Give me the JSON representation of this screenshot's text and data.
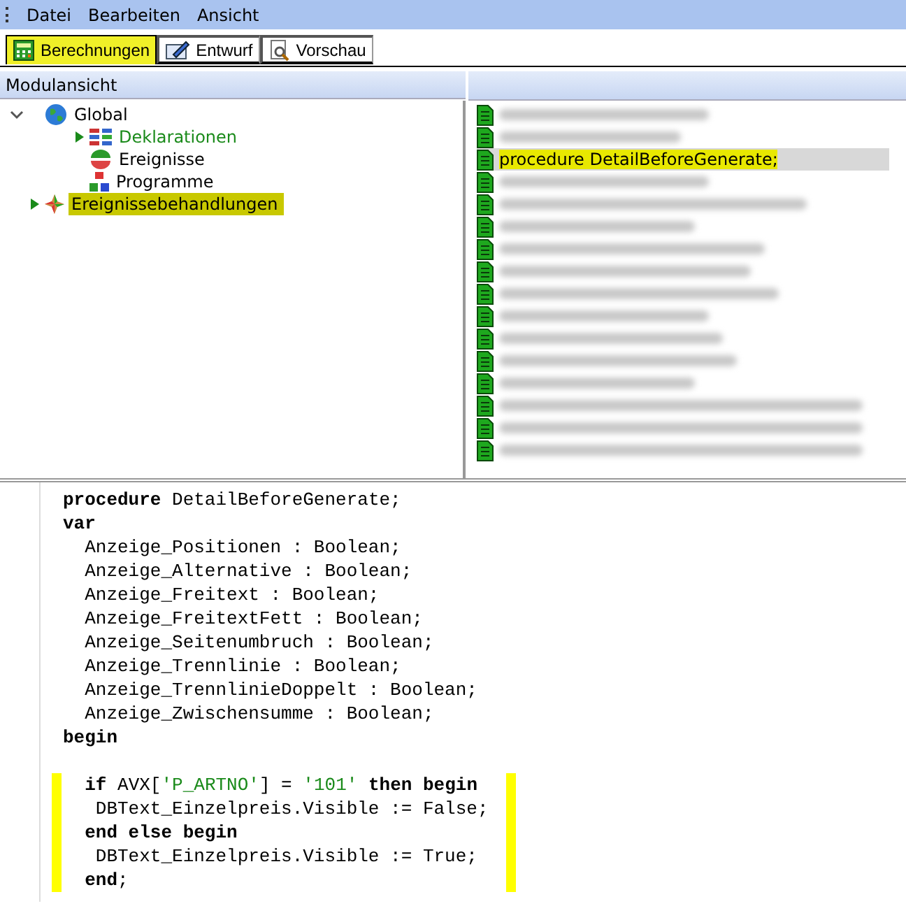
{
  "menu": [
    "Datei",
    "Bearbeiten",
    "Ansicht"
  ],
  "tabs": [
    {
      "label": "Berechnungen",
      "selected": true
    },
    {
      "label": "Entwurf",
      "selected": false
    },
    {
      "label": "Vorschau",
      "selected": false
    }
  ],
  "module_view": {
    "title": "Modulansicht",
    "tree": [
      {
        "label": "Global",
        "expanded": true,
        "selected": false,
        "active": false,
        "children": [
          {
            "label": "Deklarationen",
            "selected": false,
            "active": true
          },
          {
            "label": "Ereignisse",
            "selected": false,
            "active": false
          },
          {
            "label": "Programme",
            "selected": false,
            "active": false
          }
        ]
      },
      {
        "label": "Ereignissebehandlungen",
        "selected": true,
        "active": false
      }
    ]
  },
  "procedures": [
    {
      "kind": "blurred"
    },
    {
      "kind": "blurred"
    },
    {
      "kind": "text",
      "text": "procedure DetailBeforeGenerate;",
      "selected": true
    },
    {
      "kind": "blurred"
    },
    {
      "kind": "blurred"
    },
    {
      "kind": "blurred"
    },
    {
      "kind": "blurred"
    },
    {
      "kind": "blurred"
    },
    {
      "kind": "blurred"
    },
    {
      "kind": "blurred"
    },
    {
      "kind": "blurred"
    },
    {
      "kind": "blurred"
    },
    {
      "kind": "blurred"
    },
    {
      "kind": "blurred"
    },
    {
      "kind": "blurred"
    },
    {
      "kind": "blurred"
    }
  ],
  "editor": {
    "lines": [
      {
        "marked": false,
        "tokens": [
          {
            "kind": "keyword",
            "text": "procedure"
          },
          {
            "kind": "plain",
            "text": " DetailBeforeGenerate;"
          }
        ]
      },
      {
        "marked": false,
        "tokens": [
          {
            "kind": "keyword",
            "text": "var"
          }
        ]
      },
      {
        "marked": false,
        "tokens": [
          {
            "kind": "plain",
            "text": "  Anzeige_Positionen : Boolean;"
          }
        ]
      },
      {
        "marked": false,
        "tokens": [
          {
            "kind": "plain",
            "text": "  Anzeige_Alternative : Boolean;"
          }
        ]
      },
      {
        "marked": false,
        "tokens": [
          {
            "kind": "plain",
            "text": "  Anzeige_Freitext : Boolean;"
          }
        ]
      },
      {
        "marked": false,
        "tokens": [
          {
            "kind": "plain",
            "text": "  Anzeige_FreitextFett : Boolean;"
          }
        ]
      },
      {
        "marked": false,
        "tokens": [
          {
            "kind": "plain",
            "text": "  Anzeige_Seitenumbruch : Boolean;"
          }
        ]
      },
      {
        "marked": false,
        "tokens": [
          {
            "kind": "plain",
            "text": "  Anzeige_Trennlinie : Boolean;"
          }
        ]
      },
      {
        "marked": false,
        "tokens": [
          {
            "kind": "plain",
            "text": "  Anzeige_TrennlinieDoppelt : Boolean;"
          }
        ]
      },
      {
        "marked": false,
        "tokens": [
          {
            "kind": "plain",
            "text": "  Anzeige_Zwischensumme : Boolean;"
          }
        ]
      },
      {
        "marked": false,
        "tokens": [
          {
            "kind": "keyword",
            "text": "begin"
          }
        ]
      },
      {
        "marked": false
      },
      {
        "marked": true,
        "tokens": [
          {
            "kind": "keyword",
            "text": "  if"
          },
          {
            "kind": "plain",
            "text": " AVX["
          },
          {
            "kind": "string",
            "text": "'P_ARTNO'"
          },
          {
            "kind": "plain",
            "text": "] = "
          },
          {
            "kind": "string",
            "text": "'101'"
          },
          {
            "kind": "keyword",
            "text": " then begin"
          }
        ]
      },
      {
        "marked": true,
        "tokens": [
          {
            "kind": "plain",
            "text": "   DBText_Einzelpreis.Visible := False;"
          }
        ]
      },
      {
        "marked": true,
        "tokens": [
          {
            "kind": "keyword",
            "text": "  end else begin"
          }
        ]
      },
      {
        "marked": true,
        "tokens": [
          {
            "kind": "plain",
            "text": "   DBText_Einzelpreis.Visible := True;"
          }
        ]
      },
      {
        "marked": true,
        "tokens": [
          {
            "kind": "keyword",
            "text": "  end"
          },
          {
            "kind": "plain",
            "text": ";"
          }
        ]
      }
    ]
  }
}
